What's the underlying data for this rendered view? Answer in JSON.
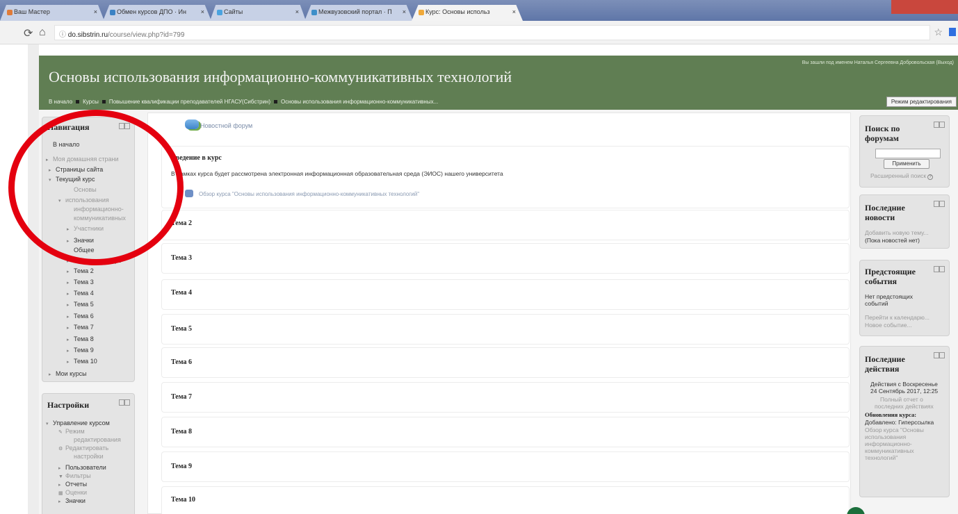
{
  "browser": {
    "tabs": [
      {
        "label": "Ваш Мастер",
        "color": "#e07b39"
      },
      {
        "label": "Обмен курсов ДПО · Ин",
        "color": "#3b82c4"
      },
      {
        "label": "Сайты",
        "color": "#4aa3df"
      },
      {
        "label": "Межвузовский портал · П",
        "color": "#3d8fc9"
      },
      {
        "label": "Курс: Основы использ",
        "color": "#f0a93a"
      }
    ],
    "url_host": "do.sibstrin.ru",
    "url_path": "/course/view.php?id=799"
  },
  "header": {
    "site_title": "Основы использования информационно-коммуникативных технологий",
    "login_info": "Вы зашли под именем Наталья Сергеевна Добровольская (Выход)",
    "breadcrumbs": [
      "В начало",
      "Курсы",
      "Повышение квалификации преподавателей НГАСУ(Сибстрин)",
      "Основы использования информационно-коммуникативных..."
    ],
    "edit_mode_label": "Режим редактирования"
  },
  "navigation": {
    "title": "Навигация",
    "items": [
      {
        "label": "В начало",
        "tri": ""
      },
      {
        "label": "Моя домашняя страни",
        "tri": "▸"
      },
      {
        "label": "Страницы сайта",
        "tri": "▸"
      },
      {
        "label": "Текущий курс",
        "tri": "▾"
      },
      {
        "label": "Основы",
        "tri": ""
      },
      {
        "label": "использования",
        "tri": "▾"
      },
      {
        "label": "информационно-",
        "tri": ""
      },
      {
        "label": "коммуникативных",
        "tri": ""
      },
      {
        "label": "Участники",
        "tri": "▸"
      },
      {
        "label": "Значки",
        "tri": "▸"
      },
      {
        "label": "Общее",
        "tri": ""
      },
      {
        "label": "Введение в курс",
        "tri": "▸"
      },
      {
        "label": "Тема 2",
        "tri": "▸"
      },
      {
        "label": "Тема 3",
        "tri": "▸"
      },
      {
        "label": "Тема 4",
        "tri": "▸"
      },
      {
        "label": "Тема 5",
        "tri": "▸"
      },
      {
        "label": "Тема 6",
        "tri": "▸"
      },
      {
        "label": "Тема 7",
        "tri": "▸"
      },
      {
        "label": "Тема 8",
        "tri": "▸"
      },
      {
        "label": "Тема 9",
        "tri": "▸"
      },
      {
        "label": "Тема 10",
        "tri": "▸"
      },
      {
        "label": "Мои курсы",
        "tri": "▸"
      }
    ]
  },
  "settings": {
    "title": "Настройки",
    "items": [
      {
        "label": "Управление курсом",
        "tri": "▾"
      },
      {
        "label": "Режим",
        "tri": "✎"
      },
      {
        "label": "редактирования",
        "tri": ""
      },
      {
        "label": "Редактировать",
        "tri": "⚙"
      },
      {
        "label": "настройки",
        "tri": ""
      },
      {
        "label": "Пользователи",
        "tri": "▸"
      },
      {
        "label": "Фильтры",
        "tri": "▼"
      },
      {
        "label": "Отчеты",
        "tri": "▸"
      },
      {
        "label": "Оценки",
        "tri": "▦"
      },
      {
        "label": "Значки",
        "tri": "▸"
      }
    ]
  },
  "main": {
    "news_forum": "Новостной форум",
    "intro_title": "Введение в курс",
    "intro_text": "В рамках курса будет рассмотрена электронная информационная образовательная среда (ЭИОС) нашего университета",
    "intro_link": "Обзор курса \"Основы использования информационно-коммуникативных технологий\"",
    "topics": [
      "Тема 2",
      "Тема 3",
      "Тема 4",
      "Тема 5",
      "Тема 6",
      "Тема 7",
      "Тема 8",
      "Тема 9",
      "Тема 10"
    ]
  },
  "forum_search": {
    "title_1": "Поиск по",
    "title_2": "форумам",
    "apply_label": "Применить",
    "advanced_label": "Расширенный поиск"
  },
  "latest_news": {
    "title_1": "Последние",
    "title_2": "новости",
    "add_topic": "Добавить новую тему...",
    "no_news": "(Пока новостей нет)"
  },
  "upcoming": {
    "title_1": "Предстоящие",
    "title_2": "события",
    "none_1": "Нет предстоящих",
    "none_2": "событий",
    "go_calendar": "Перейти к календарю...",
    "new_event": "Новое событие..."
  },
  "recent": {
    "title_1": "Последние",
    "title_2": "действия",
    "since_1": "Действия с Воскресенье",
    "since_2": "24 Сентябрь 2017, 12:25",
    "full_report_1": "Полный отчет о",
    "full_report_2": "последних действиях",
    "updates_title": "Обновления курса:",
    "added": "Добавлено: Гиперссылка",
    "link_1": "Обзор курса \"Основы",
    "link_2": "использования",
    "link_3": "информационно-",
    "link_4": "коммуникативных",
    "link_5": "технологий\""
  }
}
